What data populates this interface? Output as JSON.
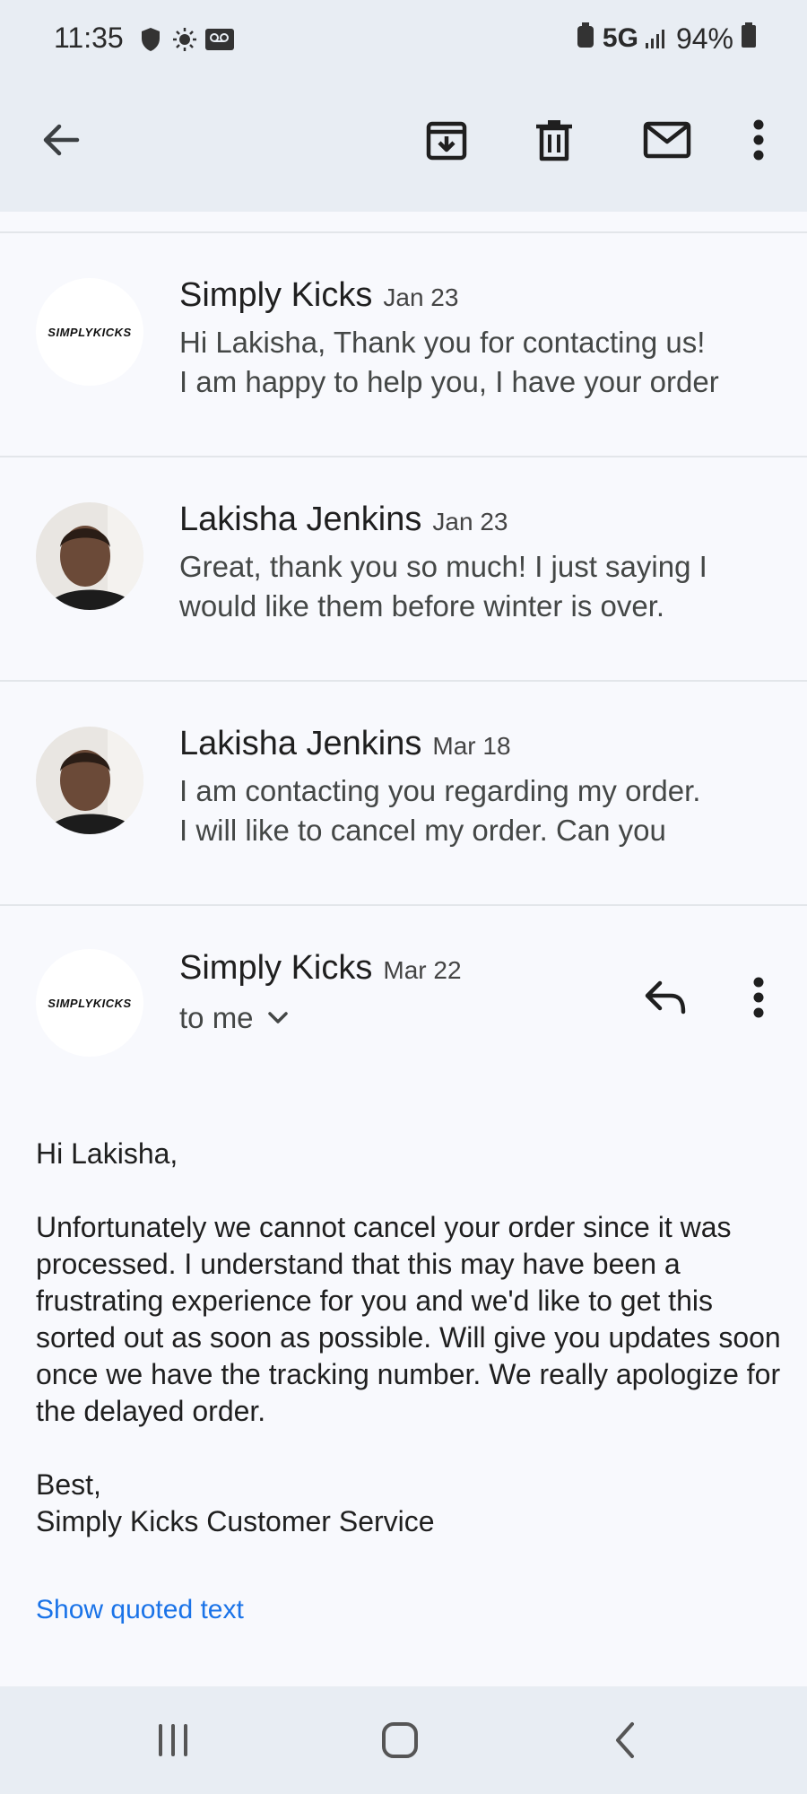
{
  "status": {
    "time": "11:35",
    "network": "5G",
    "battery": "94%"
  },
  "toolbar": {
    "back_icon": "arrow-left-icon",
    "archive_icon": "archive-icon",
    "delete_icon": "trash-icon",
    "mark_unread_icon": "mail-icon",
    "more_icon": "more-vert-icon"
  },
  "thread": [
    {
      "sender": "Simply Kicks",
      "date": "Jan 23",
      "avatar_text": "SIMPLYKICKS",
      "snippet_line1": "Hi Lakisha, Thank you for contacting us!",
      "snippet_line2": "I am happy to help you, I have your order"
    },
    {
      "sender": "Lakisha Jenkins",
      "date": "Jan 23",
      "snippet_line1": "Great, thank you so much! I just saying I",
      "snippet_line2": "would like them before winter is over."
    },
    {
      "sender": "Lakisha Jenkins",
      "date": "Mar 18",
      "snippet_line1": "I am contacting you regarding my order.",
      "snippet_line2": "I will like to cancel my order. Can you"
    }
  ],
  "message": {
    "sender": "Simply Kicks",
    "date": "Mar 22",
    "avatar_text": "SIMPLYKICKS",
    "recipient": "to me",
    "greeting": "Hi Lakisha,",
    "paragraph": "Unfortunately we cannot cancel your order since it was processed. I understand that this may have been a frustrating experience for you and we'd like to get this sorted out as soon as possible. Will give you updates soon once we have the tracking number. We really apologize for the delayed order.",
    "closing": "Best,",
    "signature": "Simply Kicks Customer Service",
    "show_quoted": "Show quoted text"
  },
  "colors": {
    "accent_link": "#1a73e8",
    "topbar_bg": "#e8edf3",
    "page_bg": "#f8f9fd"
  }
}
